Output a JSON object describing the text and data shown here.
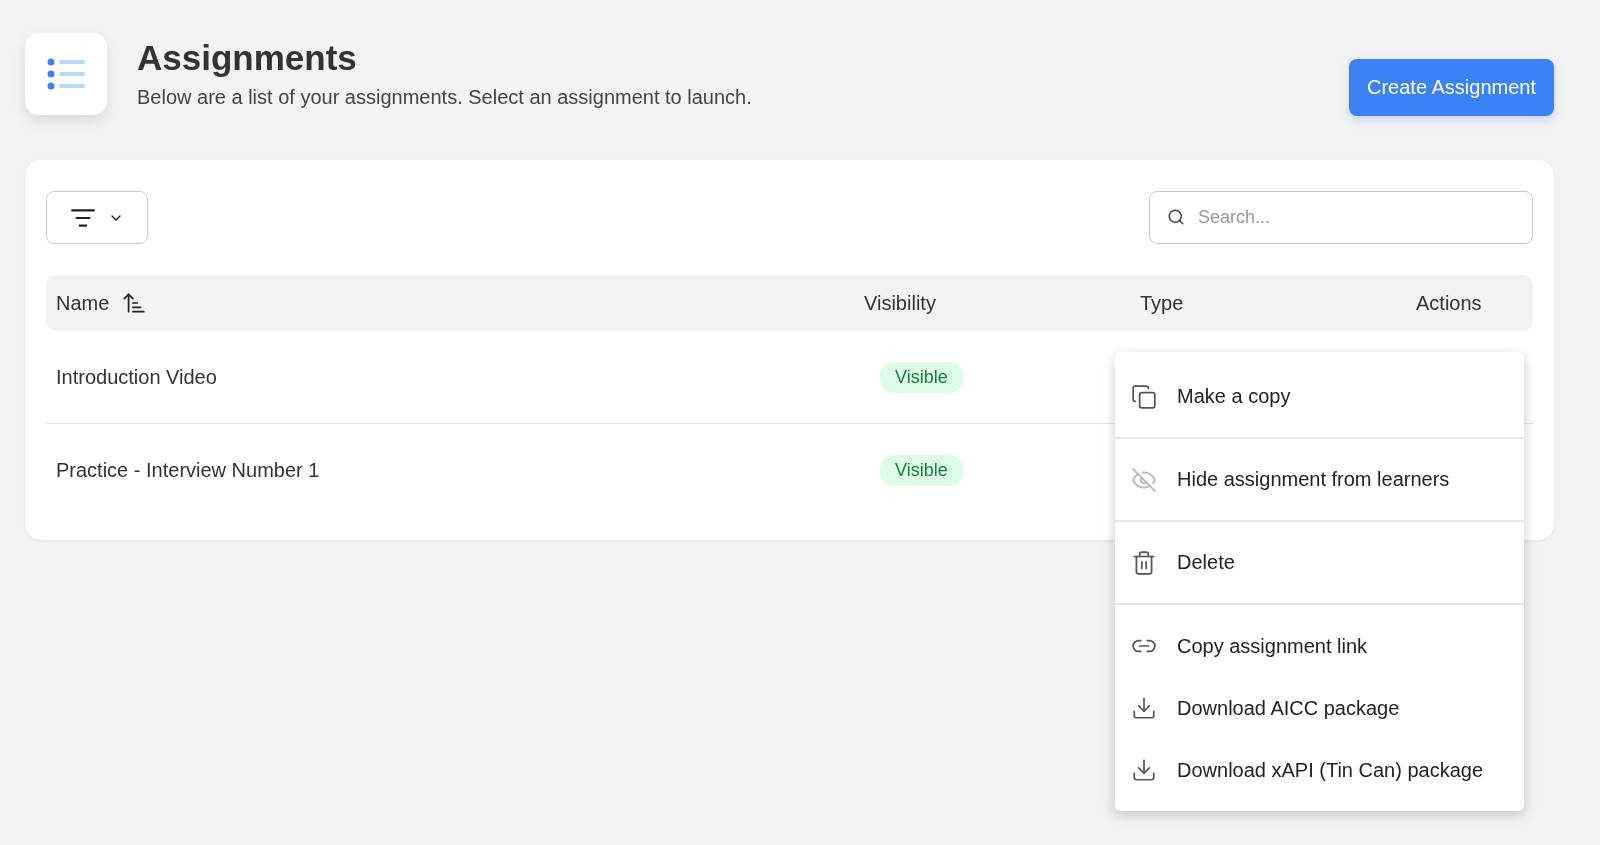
{
  "header": {
    "title": "Assignments",
    "subtitle": "Below are a list of your assignments. Select an assignment to launch.",
    "create_button": "Create Assignment"
  },
  "toolbar": {
    "search": {
      "placeholder": "Search..."
    }
  },
  "table": {
    "columns": [
      {
        "label": "Name",
        "sorted": true
      },
      {
        "label": "Visibility",
        "sorted": false
      },
      {
        "label": "Type",
        "sorted": false
      },
      {
        "label": "Actions",
        "sorted": false
      }
    ],
    "rows": [
      {
        "name": "Introduction Video",
        "visibility": "Visible",
        "visible": true
      },
      {
        "name": "Practice - Interview Number 1",
        "visibility": "Visible",
        "visible": true
      }
    ]
  },
  "actions_menu": {
    "groups": [
      [
        {
          "kind": "copy",
          "label": "Make a copy"
        }
      ],
      [
        {
          "kind": "hide",
          "label": "Hide assignment from learners"
        }
      ],
      [
        {
          "kind": "delete",
          "label": "Delete"
        }
      ],
      [
        {
          "kind": "link",
          "label": "Copy assignment link"
        },
        {
          "kind": "download",
          "label": "Download AICC package"
        },
        {
          "kind": "download",
          "label": "Download xAPI (Tin Can) package"
        }
      ]
    ]
  }
}
